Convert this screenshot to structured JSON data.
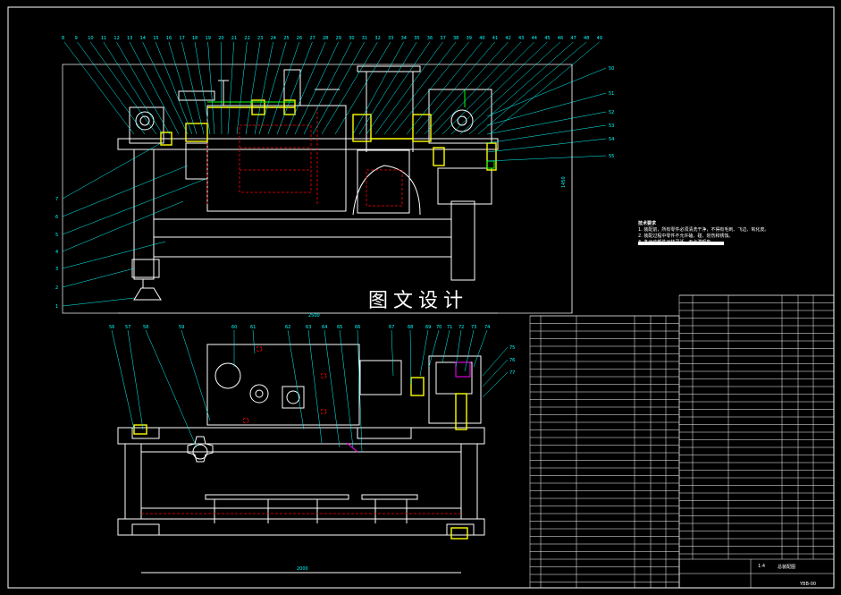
{
  "watermark": "图文设计",
  "tech_notes": {
    "title": "技术要求",
    "lines": [
      "1. 装配前，所有零件必须清洗干净，不得有毛刺、飞边、氧化皮。",
      "2. 装配过程中零件不允许磕、碰、划伤和锈蚀。",
      "3. 各运动部件运转灵活，无卡滞现象。"
    ]
  },
  "front_view": {
    "balloon_numbers_top": [
      "8",
      "9",
      "10",
      "11",
      "12",
      "13",
      "14",
      "15",
      "16",
      "17",
      "18",
      "19",
      "20",
      "21",
      "22",
      "23",
      "24",
      "25",
      "26",
      "27",
      "28",
      "29",
      "30",
      "31",
      "32",
      "33",
      "34",
      "35",
      "36",
      "37",
      "38",
      "39",
      "40",
      "41",
      "42",
      "43",
      "44",
      "45",
      "46",
      "47",
      "48",
      "49"
    ],
    "balloon_numbers_left": [
      "7",
      "6",
      "5",
      "4",
      "3",
      "2",
      "1"
    ],
    "balloon_numbers_right": [
      "50",
      "51",
      "52",
      "53",
      "54",
      "55"
    ],
    "dim_width": "2500",
    "dim_height": "1450"
  },
  "top_view": {
    "balloon_numbers_top": [
      "56",
      "57",
      "58",
      "59",
      "60",
      "61",
      "62",
      "63",
      "64",
      "65",
      "66",
      "67",
      "68",
      "69",
      "70",
      "71",
      "72",
      "73",
      "74"
    ],
    "balloon_numbers_right": [
      "75",
      "76",
      "77"
    ],
    "dim_width": "2000"
  },
  "parts_table": {
    "title_block_name": "总装配图",
    "scale": "1:4",
    "drawing_no": "YBB-00"
  },
  "colors": {
    "background": "#000000",
    "outline": "#ffffff",
    "leader": "#00ffff",
    "hidden": "#ff0000",
    "parts": "#ffff00",
    "accent": "#ff00ff",
    "green": "#00ff00"
  }
}
